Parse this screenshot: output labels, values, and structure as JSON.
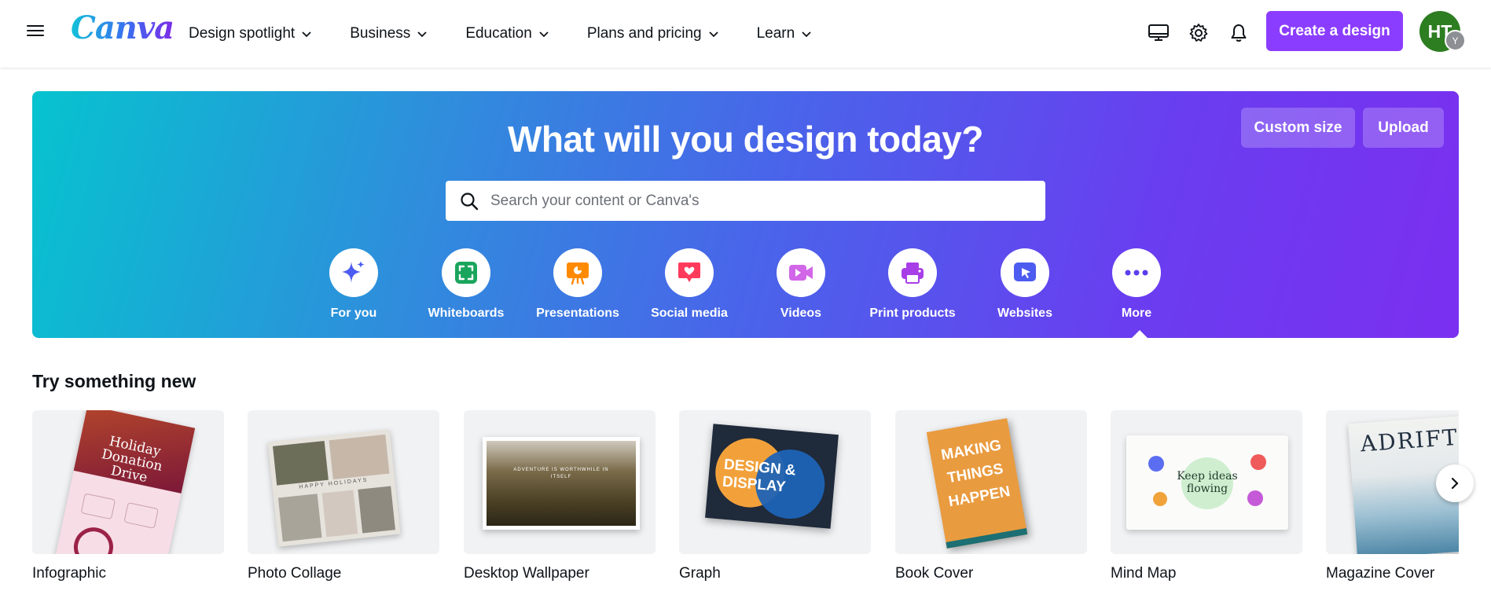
{
  "header": {
    "logo": "Canva",
    "nav": [
      {
        "label": "Design spotlight"
      },
      {
        "label": "Business"
      },
      {
        "label": "Education"
      },
      {
        "label": "Plans and pricing"
      },
      {
        "label": "Learn"
      }
    ],
    "icons": [
      "desktop-icon",
      "gear-icon",
      "bell-icon"
    ],
    "create_label": "Create a design",
    "avatar_initials": "HT",
    "avatar_badge": "Y",
    "colors": {
      "accent": "#8b3dff",
      "avatar": "#2d7d21"
    }
  },
  "hero": {
    "title": "What will you design today?",
    "custom_size": "Custom size",
    "upload": "Upload",
    "search_placeholder": "Search your content or Canva's",
    "categories": [
      {
        "label": "For you",
        "icon": "sparkle-icon",
        "color": "#4c5bf0"
      },
      {
        "label": "Whiteboards",
        "icon": "whiteboard-icon",
        "color": "#1aa55c"
      },
      {
        "label": "Presentations",
        "icon": "presentation-icon",
        "color": "#ff8a00"
      },
      {
        "label": "Social media",
        "icon": "heart-icon",
        "color": "#ff3b5c"
      },
      {
        "label": "Videos",
        "icon": "video-icon",
        "color": "#d166e8"
      },
      {
        "label": "Print products",
        "icon": "printer-icon",
        "color": "#a83ee8"
      },
      {
        "label": "Websites",
        "icon": "cursor-icon",
        "color": "#4c5bf0"
      },
      {
        "label": "More",
        "icon": "more-icon",
        "color": "#5b3df0"
      }
    ]
  },
  "try_new": {
    "title": "Try something new",
    "cards": [
      {
        "label": "Infographic",
        "thumb_text": "Holiday Donation Drive"
      },
      {
        "label": "Photo Collage",
        "thumb_text": "HAPPY HOLIDAYS"
      },
      {
        "label": "Desktop Wallpaper",
        "thumb_text": "ADVENTURE IS WORTHWHILE IN ITSELF"
      },
      {
        "label": "Graph",
        "thumb_text": "DESIGN & DISPLAY"
      },
      {
        "label": "Book Cover",
        "thumb_text": "MAKING THINGS HAPPEN"
      },
      {
        "label": "Mind Map",
        "thumb_text": "Keep ideas flowing"
      },
      {
        "label": "Magazine Cover",
        "thumb_text": "ADRIFT"
      }
    ]
  }
}
